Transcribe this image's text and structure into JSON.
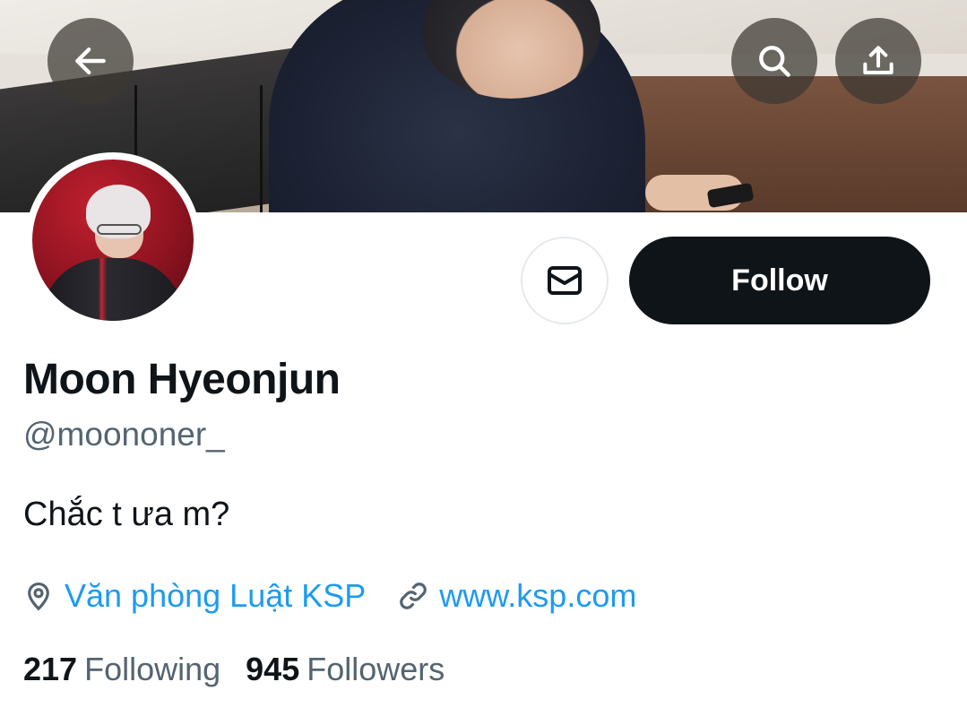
{
  "profile": {
    "name": "Moon Hyeonjun",
    "handle": "@moononer_",
    "bio": "Chắc t ưa m?",
    "location": "Văn phòng Luật KSP",
    "website": "www.ksp.com",
    "following_count": "217",
    "following_label": "Following",
    "followers_count": "945",
    "followers_label": "Followers"
  },
  "actions": {
    "follow_label": "Follow"
  },
  "icons": {
    "back": "arrow-left-icon",
    "search": "search-icon",
    "share": "share-upload-icon",
    "message": "envelope-icon",
    "location": "location-pin-icon",
    "link": "link-icon"
  },
  "colors": {
    "primary_text": "#0f1419",
    "secondary_text": "#536471",
    "link": "#1d9bf0",
    "follow_button_bg": "#0f1419"
  }
}
